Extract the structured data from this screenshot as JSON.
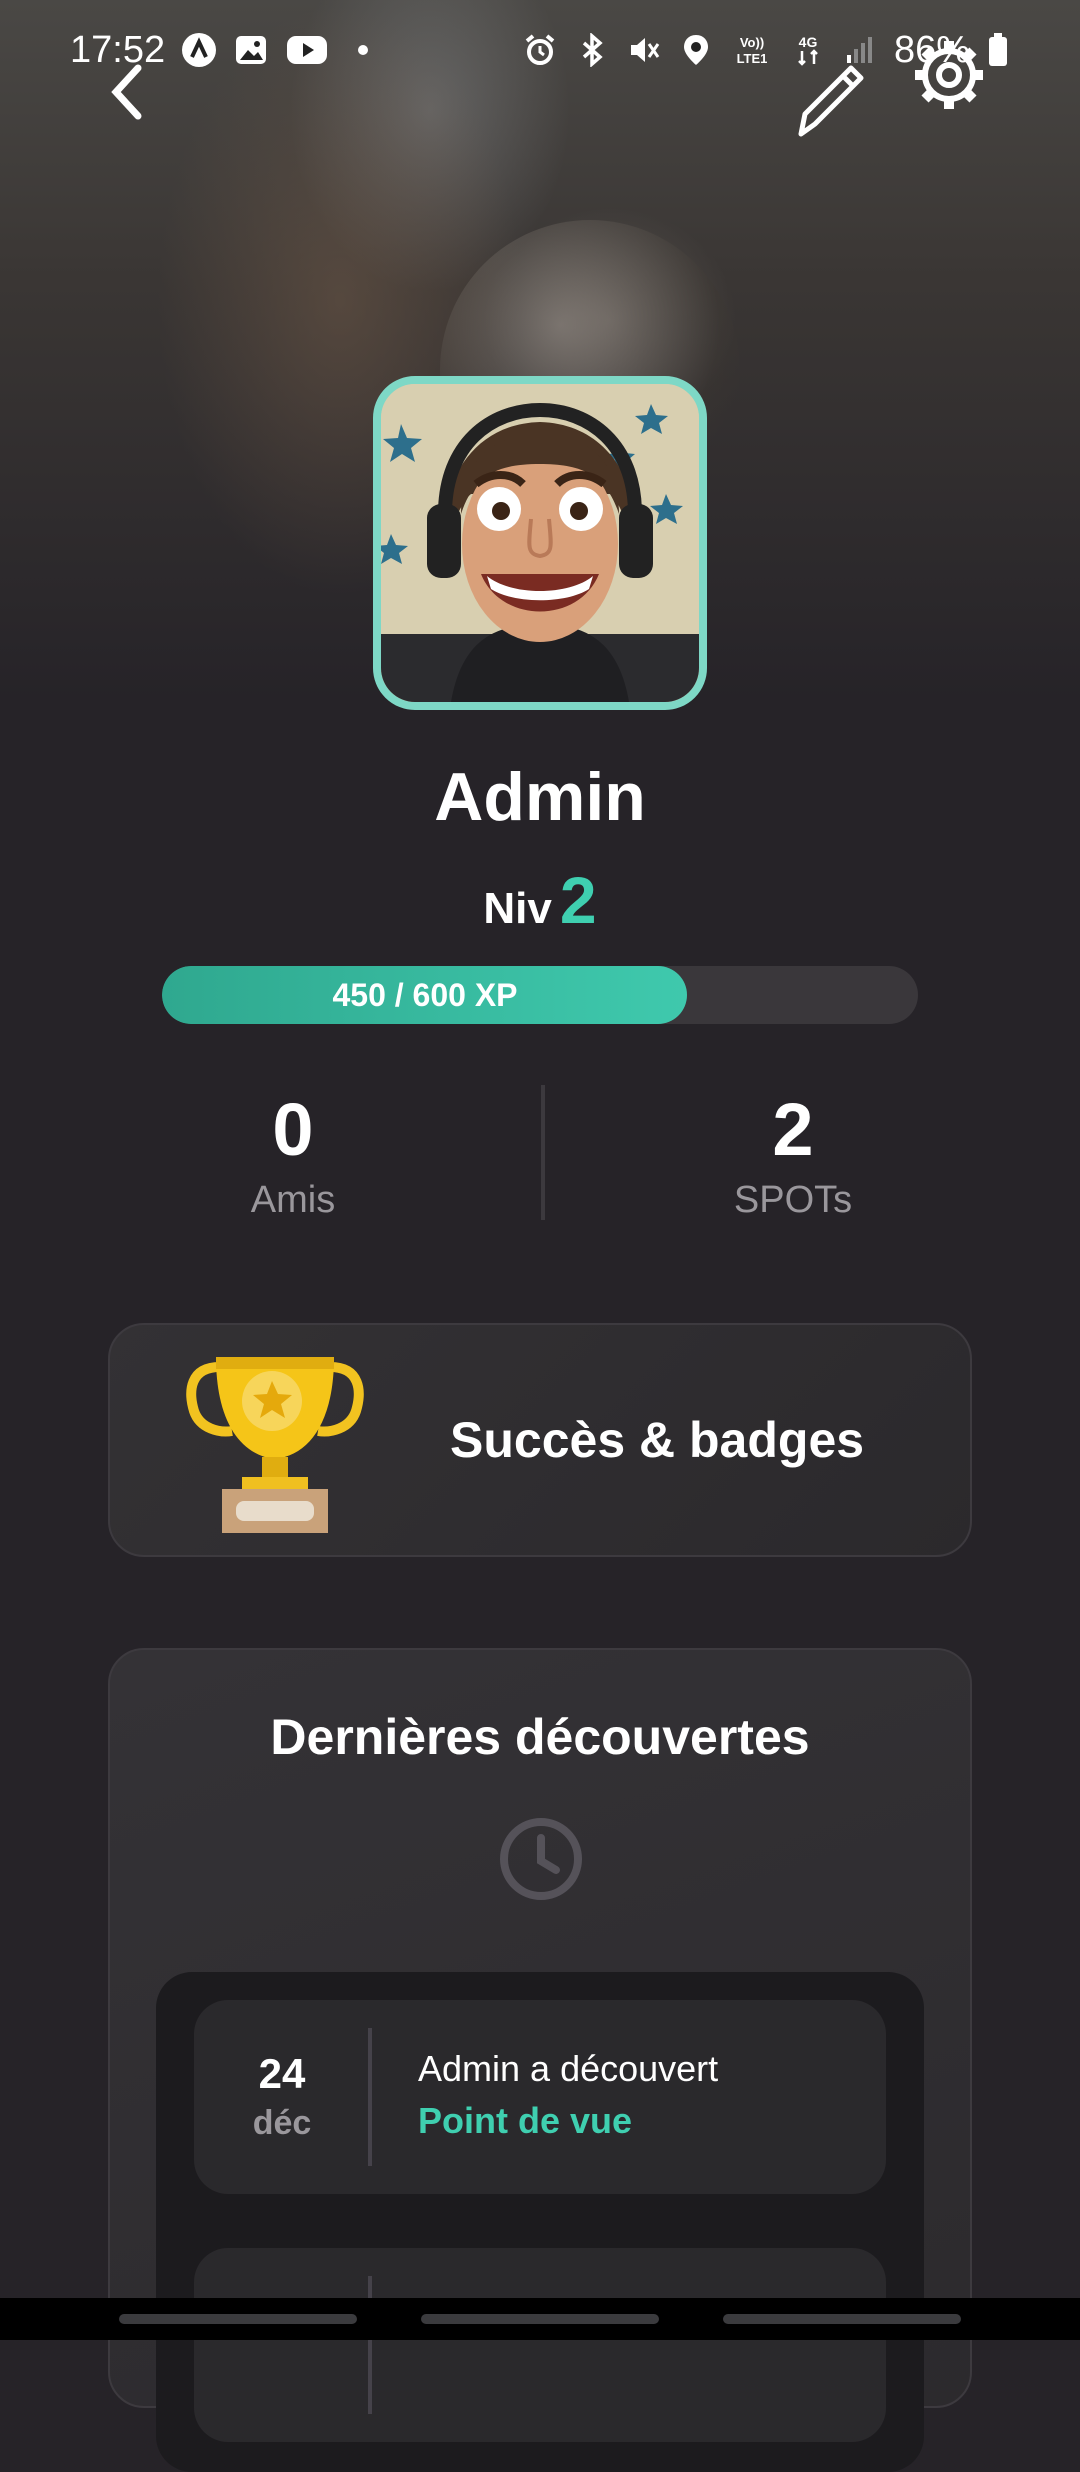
{
  "status_bar": {
    "time": "17:52",
    "battery": "86%",
    "left_icons": [
      "app-a-icon",
      "image-icon",
      "youtube-icon",
      "dot-icon"
    ],
    "right_icons": [
      "alarm-icon",
      "bluetooth-icon",
      "mute-icon",
      "location-icon",
      "volte-icon",
      "4g-icon",
      "signal-icon",
      "battery-icon"
    ]
  },
  "nav": {
    "back_icon": "chevron-left-icon",
    "edit_icon": "pencil-icon",
    "settings_icon": "gear-icon"
  },
  "profile": {
    "name": "Admin",
    "level_label": "Niv",
    "level": "2",
    "xp_text": "450 / 600 XP",
    "xp_progress": 0.75,
    "accent_color": "#3fcfb0"
  },
  "stats": {
    "friends_value": "0",
    "friends_label": "Amis",
    "spots_value": "2",
    "spots_label": "SPOTs"
  },
  "badges": {
    "title": "Succès & badges",
    "icon": "trophy-icon"
  },
  "discoveries": {
    "title": "Dernières découvertes",
    "icon": "clock-icon",
    "items": [
      {
        "day": "24",
        "month": "déc",
        "text": "Admin a découvert",
        "place": "Point de vue"
      }
    ]
  }
}
